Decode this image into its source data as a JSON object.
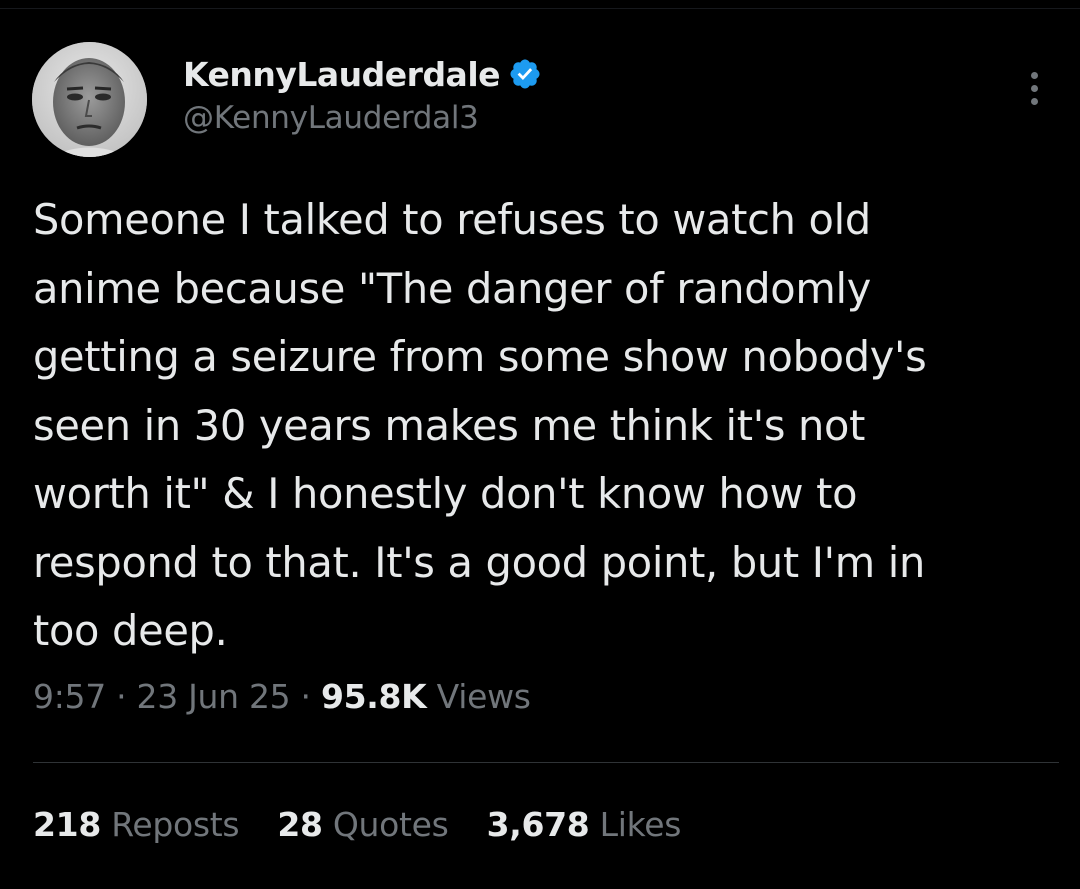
{
  "tweet": {
    "author": {
      "display_name": "KennyLauderdale",
      "handle": "@KennyLauderdal3",
      "verified": true,
      "verified_color": "#1d9bf0"
    },
    "text": "Someone I talked to refuses to watch old\nanime because \"The danger of randomly\ngetting a seizure from some show nobody's\nseen in 30 years makes me think it's not\nworth it\" & I honestly don't know how to\nrespond to that. It's a good point, but I'm in\ntoo deep.",
    "time": "9:57",
    "date": "23 Jun 25",
    "separator": "·",
    "views_count": "95.8K",
    "views_label": "Views",
    "stats": {
      "reposts_count": "218",
      "reposts_label": "Reposts",
      "quotes_count": "28",
      "quotes_label": "Quotes",
      "likes_count": "3,678",
      "likes_label": "Likes"
    }
  },
  "icons": {
    "avatar": "avatar",
    "verified": "verified-badge-icon",
    "more": "more-options-icon"
  },
  "colors": {
    "background": "#000000",
    "primary_text": "#e7e9ea",
    "secondary_text": "#71767b",
    "divider": "#2f3336"
  }
}
